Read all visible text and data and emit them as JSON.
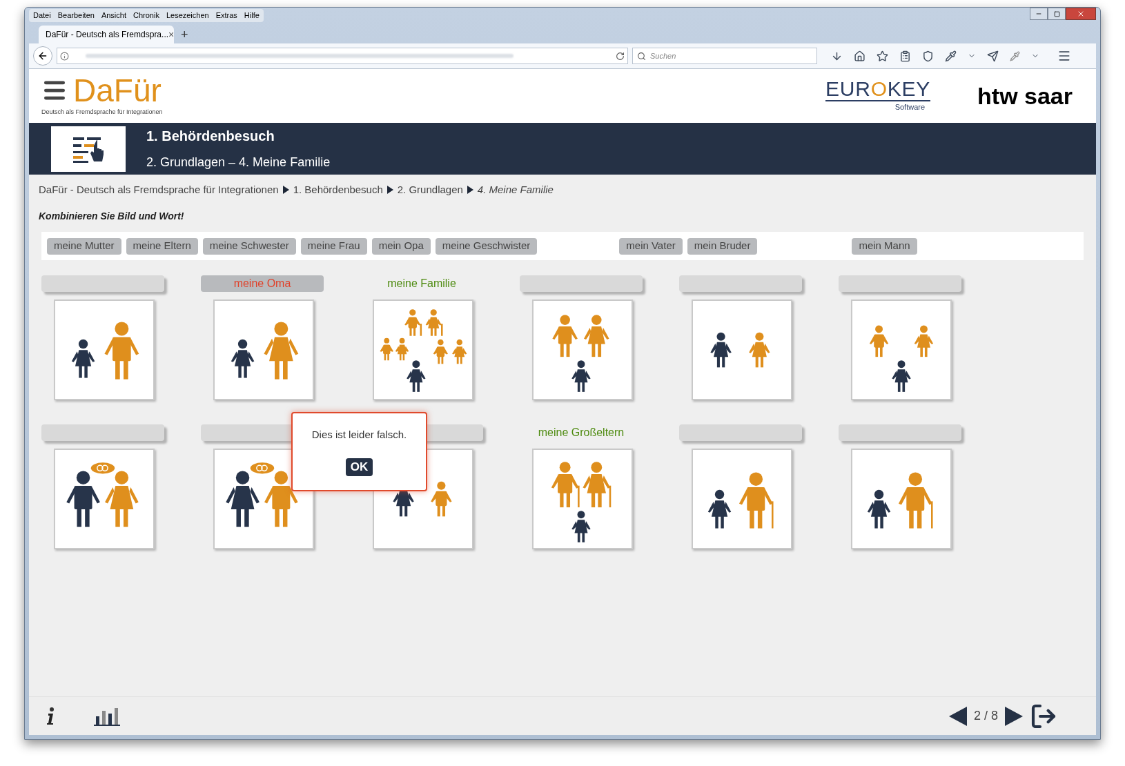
{
  "browser": {
    "menu": [
      "Datei",
      "Bearbeiten",
      "Ansicht",
      "Chronik",
      "Lesezeichen",
      "Extras",
      "Hilfe"
    ],
    "tab": {
      "title": "DaFür - Deutsch als Fremdspra...",
      "close": "×",
      "new": "+"
    },
    "search": {
      "placeholder": "Suchen"
    }
  },
  "header": {
    "logo": "DaFür",
    "tagline": "Deutsch als Fremdsprache für Integrationen",
    "partner_parts": [
      "EUR",
      "O",
      "KEY"
    ],
    "partner_sub": "Software",
    "university": "htw saar"
  },
  "banner": {
    "title": "1. Behördenbesuch",
    "subtitle": "2. Grundlagen – 4. Meine Familie"
  },
  "breadcrumb": [
    {
      "label": "DaFür - Deutsch als Fremdsprache für Integrationen",
      "current": false
    },
    {
      "label": "1. Behördenbesuch",
      "current": false
    },
    {
      "label": "2. Grundlagen",
      "current": false
    },
    {
      "label": "4. Meine Familie",
      "current": true
    }
  ],
  "instruction": "Kombinieren Sie Bild und Wort!",
  "word_bank": [
    "meine Mutter",
    "meine Eltern",
    "meine Schwester",
    "meine Frau",
    "mein Opa",
    "meine Geschwister",
    "mein Vater",
    "mein Bruder",
    "mein Mann"
  ],
  "tiles": [
    {
      "filled": false
    },
    {
      "filled": true,
      "label": "meine Oma",
      "correct": false
    },
    {
      "filled": true,
      "label": "meine Familie",
      "correct": true
    },
    {
      "filled": false
    },
    {
      "filled": false
    },
    {
      "filled": false
    },
    {
      "filled": false
    },
    {
      "filled": false
    },
    {
      "filled": false
    },
    {
      "filled": true,
      "label": "meine Großeltern",
      "correct": true
    },
    {
      "filled": false
    },
    {
      "filled": false
    }
  ],
  "dialog": {
    "message": "Dies ist leider falsch.",
    "button": "OK"
  },
  "pager": {
    "page": "2 / 8"
  }
}
